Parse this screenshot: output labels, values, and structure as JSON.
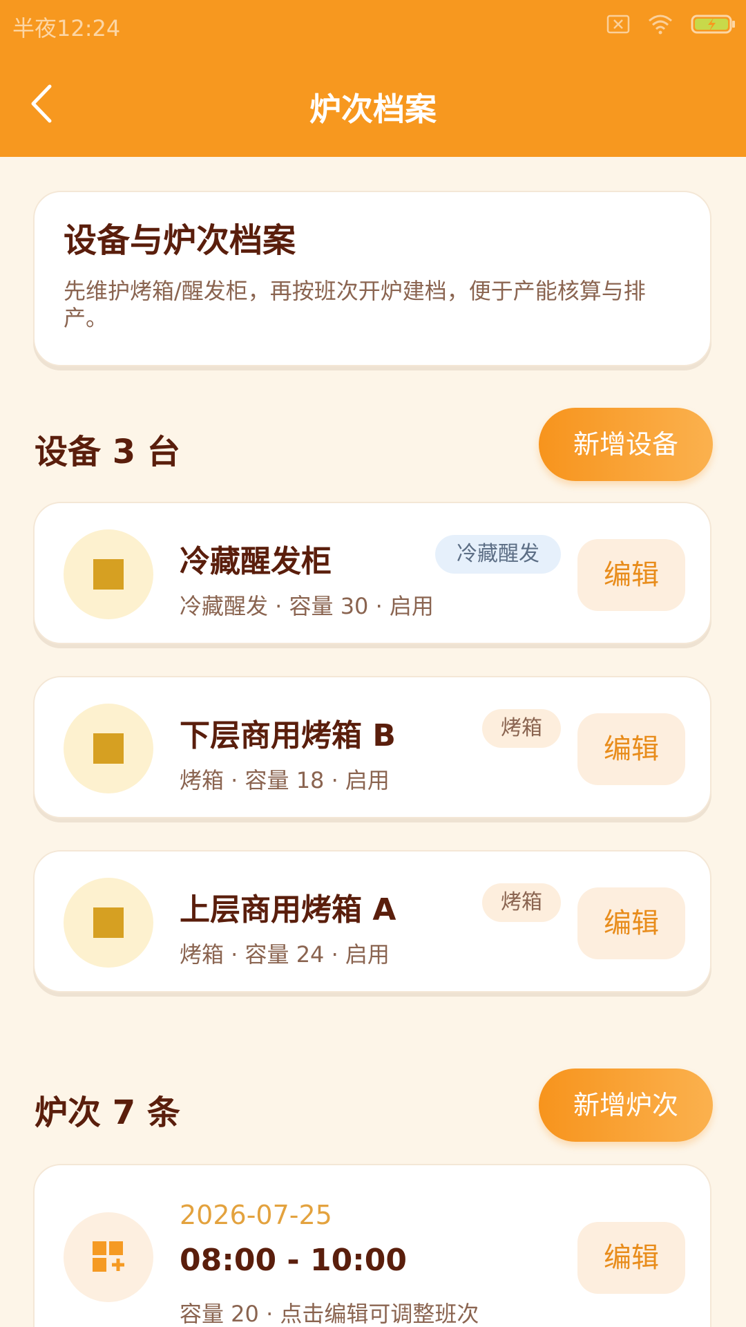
{
  "status_bar": {
    "time": "半夜12:24"
  },
  "header": {
    "title": "炉次档案"
  },
  "intro": {
    "title": "设备与炉次档案",
    "description": "先维护烤箱/醒发柜，再按班次开炉建档，便于产能核算与排产。"
  },
  "devices": {
    "section_title": "设备 3 台",
    "add_label": "新增设备",
    "items": [
      {
        "name": "冷藏醒发柜",
        "tag": "冷藏醒发",
        "meta": "冷藏醒发 · 容量 30 · 启用",
        "edit_label": "编辑"
      },
      {
        "name": "下层商用烤箱 B",
        "tag": "烤箱",
        "meta": "烤箱 · 容量 18 · 启用",
        "edit_label": "编辑"
      },
      {
        "name": "上层商用烤箱 A",
        "tag": "烤箱",
        "meta": "烤箱 · 容量 24 · 启用",
        "edit_label": "编辑"
      }
    ]
  },
  "batches": {
    "section_title": "炉次 7 条",
    "add_label": "新增炉次",
    "items": [
      {
        "date": "2026-07-25",
        "time_range": "08:00 - 10:00",
        "meta": "容量 20 · 点击编辑可调整班次",
        "edit_label": "编辑"
      }
    ]
  },
  "colors": {
    "header_bg": "#f7981f",
    "page_bg": "#fdf5e8",
    "accent": "#f7941d",
    "device_icon": "#d6a022",
    "batch_icon": "#f59a23"
  },
  "icons": {
    "back": "chevron-left-icon",
    "sim": "no-sim-icon",
    "wifi": "wifi-icon",
    "battery": "battery-charging-icon",
    "device": "square-icon",
    "batch": "grid-add-icon"
  }
}
